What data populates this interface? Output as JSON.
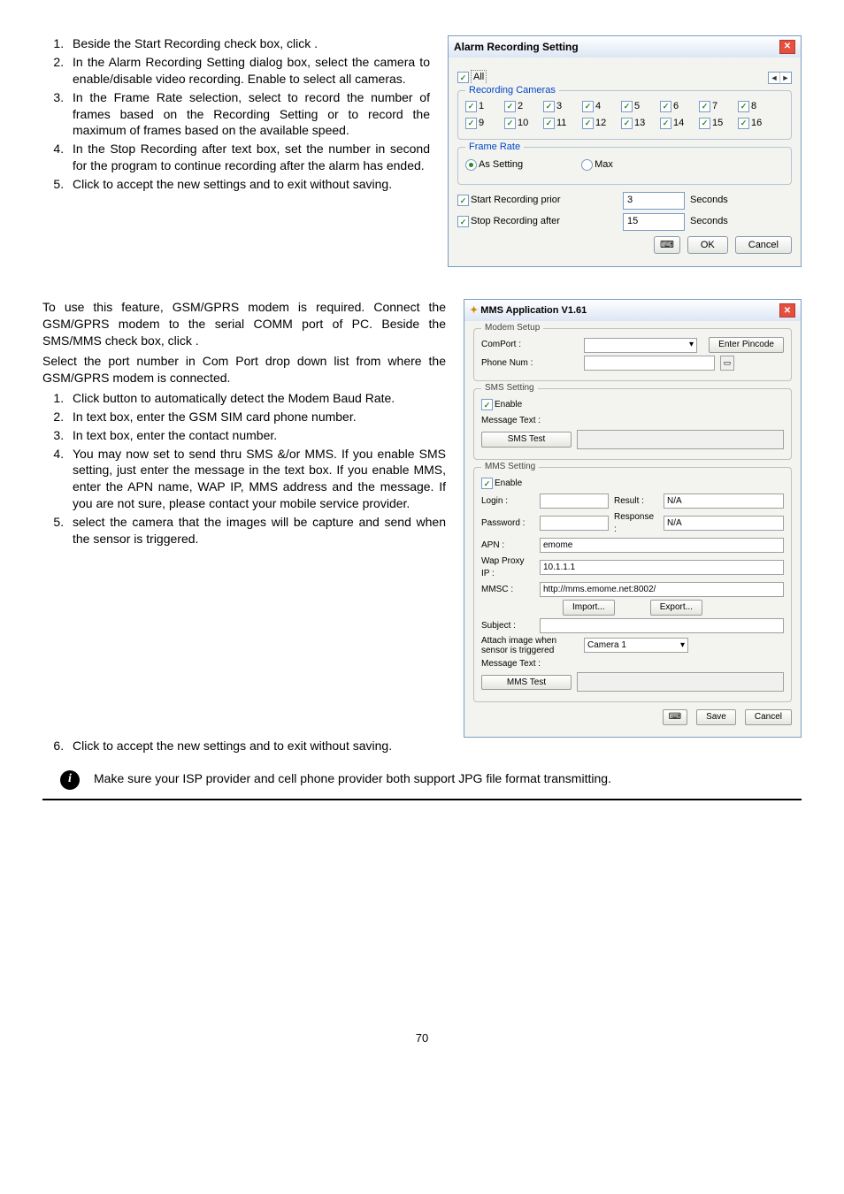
{
  "section1": {
    "items": [
      "Beside the Start Recording check box, click .",
      "In the Alarm Recording Setting dialog box, select the camera to enable/disable video recording. Enable to select all cameras.",
      "In the Frame Rate selection, select to record the number of frames based on the Recording Setting or to record the maximum of frames based on the available speed.",
      "In the Stop Recording after text box, set the number in second for the program to continue recording after the alarm has ended.",
      "Click to accept the new settings and to exit without saving."
    ]
  },
  "alarm_dialog": {
    "title": "Alarm Recording Setting",
    "all_label": "All",
    "recording_cameras_legend": "Recording Cameras",
    "cameras": [
      "1",
      "2",
      "3",
      "4",
      "5",
      "6",
      "7",
      "8",
      "9",
      "10",
      "11",
      "12",
      "13",
      "14",
      "15",
      "16"
    ],
    "frame_rate_legend": "Frame Rate",
    "as_setting": "As Setting",
    "max": "Max",
    "start_rec_label": "Start Recording prior",
    "start_rec_val": "3",
    "stop_rec_label": "Stop Recording after",
    "stop_rec_val": "15",
    "seconds": "Seconds",
    "ok": "OK",
    "cancel": "Cancel"
  },
  "section2_intro": "To use this feature, GSM/GPRS modem is required. Connect the GSM/GPRS modem to the serial COMM port of PC. Beside the SMS/MMS check box, click .",
  "section2_intro2": "Select the port number in Com Port drop down list from where the GSM/GPRS modem is connected.",
  "section2_items": [
    "Click button to automatically detect the Modem Baud Rate.",
    "In text box, enter the GSM SIM card phone number.",
    "In text box, enter the contact number.",
    "You may now set to send thru SMS &/or MMS. If you enable SMS setting, just enter the message in the text box. If you enable MMS, enter the APN name, WAP IP, MMS address and the message. If you are not sure, please contact your mobile service provider.",
    "select the camera that the images will be capture and send when the sensor is triggered.",
    "Click to accept the new settings and to exit without saving."
  ],
  "mms": {
    "title": "MMS Application V1.61",
    "modem_setup": "Modem Setup",
    "comport": "ComPort :",
    "enter_pincode": "Enter Pincode",
    "phone_num": "Phone Num :",
    "sms_setting": "SMS Setting",
    "enable": "Enable",
    "message_text": "Message Text :",
    "sms_test": "SMS Test",
    "mms_setting": "MMS Setting",
    "login": "Login :",
    "result": "Result :",
    "na": "N/A",
    "password": "Password :",
    "response": "Response :",
    "apn": "APN :",
    "apn_val": "emome",
    "wap": "Wap Proxy IP :",
    "wap_val": "10.1.1.1",
    "mmsc": "MMSC :",
    "mmsc_val": "http://mms.emome.net:8002/",
    "import": "Import...",
    "export": "Export...",
    "subject": "Subject :",
    "attach": "Attach image when sensor is triggered",
    "attach_val": "Camera 1",
    "mms_test": "MMS Test",
    "save": "Save",
    "cancel": "Cancel"
  },
  "info_note": "Make sure your ISP provider and cell phone provider both support JPG file format transmitting.",
  "page_number": "70"
}
